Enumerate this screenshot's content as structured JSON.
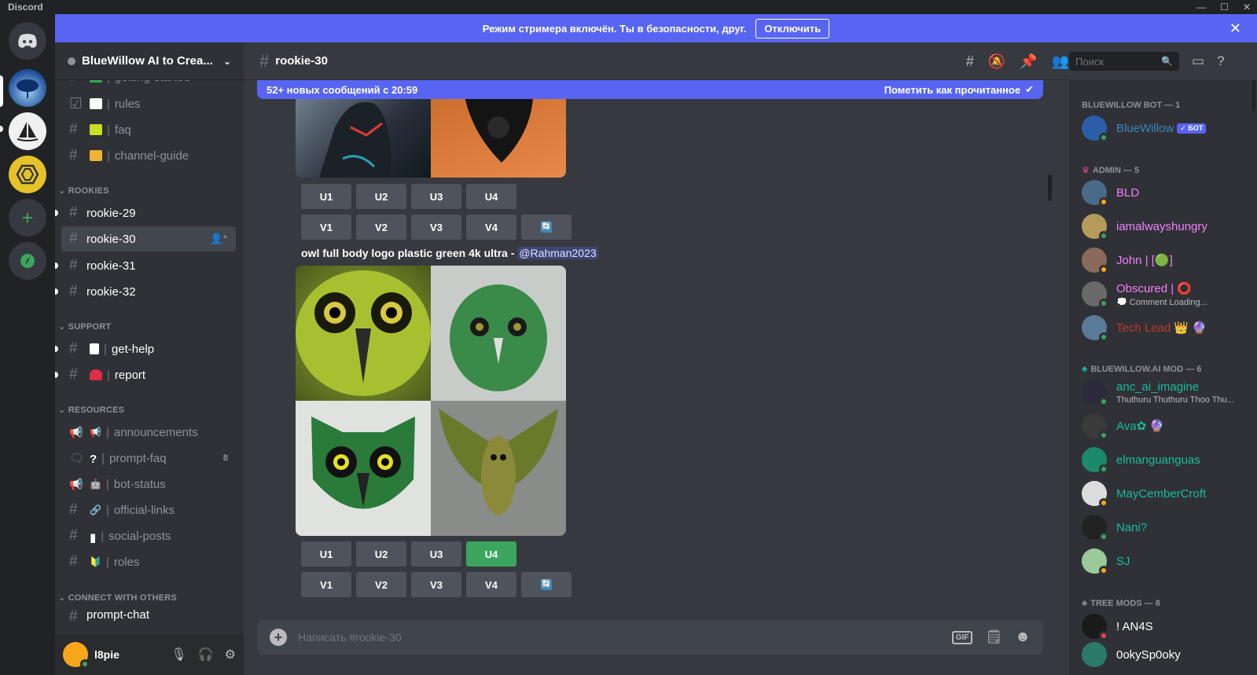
{
  "app": {
    "title": "Discord"
  },
  "window_controls": {
    "minimize": "—",
    "maximize": "☐",
    "close": "✕"
  },
  "notice": {
    "text": "Режим стримера включён. Ты в безопасности, друг.",
    "button": "Отключить",
    "close": "✕"
  },
  "server": {
    "name": "BlueWillow AI to Crea...",
    "chevron": "⌄"
  },
  "channels": [
    {
      "name": "getting-started",
      "emoji_color": "#3ba55d"
    },
    {
      "name": "rules",
      "emoji_color": "#ffffff"
    },
    {
      "name": "faq",
      "emoji_color": "#c7e023"
    },
    {
      "name": "channel-guide",
      "emoji_color": "#f0b232"
    }
  ],
  "categories": {
    "rookies": "ROOKIES",
    "support": "SUPPORT",
    "resources": "RESOURCES",
    "connect": "CONNECT WITH OTHERS"
  },
  "rookies": [
    {
      "name": "rookie-29"
    },
    {
      "name": "rookie-30"
    },
    {
      "name": "rookie-31"
    },
    {
      "name": "rookie-32"
    }
  ],
  "support": [
    {
      "name": "get-help",
      "emoji_color": "#ffffff"
    },
    {
      "name": "report",
      "emoji_color": "#dd2e44"
    }
  ],
  "resources": [
    {
      "name": "announcements",
      "icon": "📢"
    },
    {
      "name": "prompt-faq",
      "icon": "?",
      "badge": "8"
    },
    {
      "name": "bot-status",
      "icon": "🤖"
    },
    {
      "name": "official-links",
      "icon": "🔗"
    },
    {
      "name": "social-posts",
      "icon": "▮"
    },
    {
      "name": "roles",
      "icon": "🔰"
    }
  ],
  "connect": [
    {
      "name": "prompt-chat"
    }
  ],
  "user": {
    "name": "l8pie"
  },
  "chat": {
    "channel": "rookie-30",
    "new_messages": "52+ новых сообщений с 20:59",
    "mark_read": "Пометить как прочитанное",
    "prompt_text": "owl full body logo plastic green 4k ultra - ",
    "mention": "@Rahman2023",
    "u_buttons": [
      "U1",
      "U2",
      "U3",
      "U4"
    ],
    "v_buttons": [
      "V1",
      "V2",
      "V3",
      "V4"
    ],
    "refresh_glyph": "🔄",
    "placeholder": "Написать #rookie-30"
  },
  "search": {
    "placeholder": "Поиск"
  },
  "member_groups": [
    {
      "title": "BLUEWILLOW BOT — 1"
    },
    {
      "title": "ADMIN — 5"
    },
    {
      "title": "BLUEWILLOW.AI MOD — 6"
    },
    {
      "title": "TREE MODS — 8"
    }
  ],
  "members": [
    {
      "name": "BlueWillow",
      "color": "#3b88c3",
      "badge": "✓ БОТ",
      "avatar": "#2a5ea8"
    },
    {
      "name": "BLD",
      "color": "#f47fff",
      "avatar": "#4a6a8a"
    },
    {
      "name": "iamalwayshungry",
      "color": "#f47fff",
      "avatar": "#b59a5a"
    },
    {
      "name": "John | [🟢]",
      "color": "#f47fff",
      "avatar": "#8a6a5a"
    },
    {
      "name": "Obscured | ⭕",
      "color": "#f47fff",
      "sub": "💭 Comment Loading...",
      "avatar": "#6a6a6a"
    },
    {
      "name": "Tech Lead 👑 🔮",
      "color": "#c0392b",
      "avatar": "#5a7a9a"
    },
    {
      "name": "anc_ai_imagine",
      "color": "#1abc9c",
      "sub": "Thuthuru Thuthuru Thoo Thu...",
      "avatar": "#2a2a3a"
    },
    {
      "name": "Ava✿ 🔮",
      "color": "#1abc9c",
      "avatar": "#3a3a3a"
    },
    {
      "name": "elmanguanguas",
      "color": "#1abc9c",
      "avatar": "#1a8a6a"
    },
    {
      "name": "MayCemberCroft",
      "color": "#1abc9c",
      "avatar": "#dddddd"
    },
    {
      "name": "Nani?",
      "color": "#1abc9c",
      "avatar": "#222222"
    },
    {
      "name": "SJ",
      "color": "#1abc9c",
      "avatar": "#9aca9a"
    },
    {
      "name": "! AN4S",
      "color": "#ffffff",
      "avatar": "#1a1a1a"
    },
    {
      "name": "0okySp0oky",
      "color": "#ffffff",
      "avatar": "#2a7a6a"
    }
  ]
}
